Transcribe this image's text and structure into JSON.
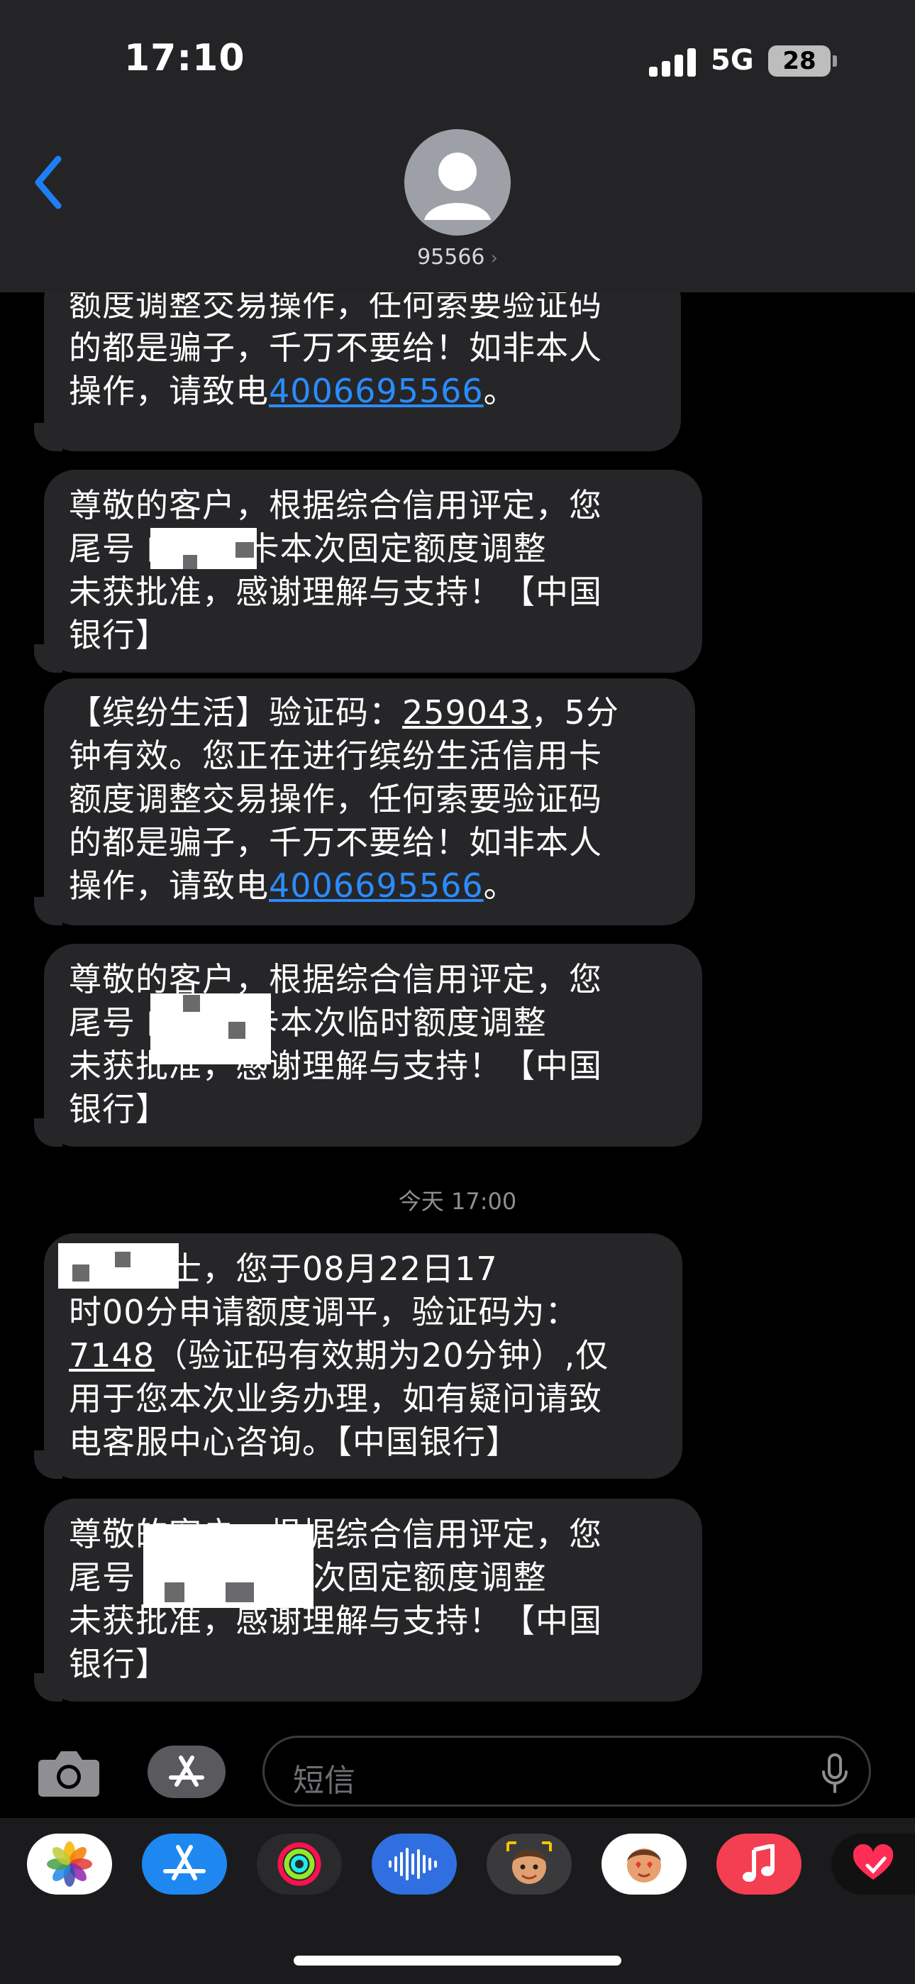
{
  "status_bar": {
    "time": "17:10",
    "network": "5G",
    "battery": "28"
  },
  "header": {
    "contact": "95566",
    "contact_chevron": "›"
  },
  "messages": [
    {
      "text": "讲有效。您正在进行缤纷生活信用卡\n额度调整交易操作，任何索要验证码\n的都是骗子，千万不要给！如非本人\n操作，请致电",
      "link": "4006695566",
      "suffix": "。"
    },
    {
      "text": "尊敬的客户，根据综合信用评定，您\n尾号      的信用卡本次固定额度调整\n未获批准，感谢理解与支持！【中国\n银行】"
    },
    {
      "prefix": "【缤纷生活】验证码：",
      "code": "259043",
      "text": "，5分\n钟有效。您正在进行缤纷生活信用卡\n额度调整交易操作，任何索要验证码\n的都是骗子，千万不要给！如非本人\n操作，请致电",
      "link": "4006695566",
      "suffix": "。"
    },
    {
      "text": "尊敬的客户，根据综合信用评定，您\n尾号      的信用卡本次临时额度调整\n未获批准，感谢理解与支持！【中国\n银行】"
    },
    {
      "prefix": "      先生女士，您于08月22日17\n时00分申请额度调平，验证码为：\n",
      "code": "7148",
      "text": "（验证码有效期为20分钟）,仅\n用于您本次业务办理，如有疑问请致\n电客服中心咨询。【中国银行】"
    },
    {
      "text": "尊敬的客户，根据综合信用评定，您\n尾号      的信用卡本次固定额度调整\n未获批准，感谢理解与支持！【中国\n银行】"
    }
  ],
  "timestamp": "今天 17:00",
  "input": {
    "placeholder": "短信"
  },
  "apps": [
    "photos-app",
    "app-store-app",
    "fitness-app",
    "audio-app",
    "memoji-app",
    "memoji-stickers-app",
    "music-app",
    "digital-touch-app"
  ],
  "colors": {
    "bubble": "#262628",
    "link": "#2b8cff",
    "header": "#242426"
  }
}
